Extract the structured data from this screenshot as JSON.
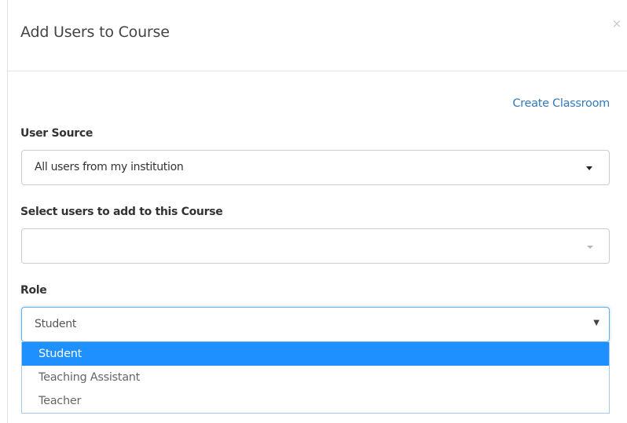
{
  "modal": {
    "title": "Add Users to Course",
    "close_glyph": "×",
    "create_classroom_label": "Create Classroom"
  },
  "user_source": {
    "label": "User Source",
    "value": "All users from my institution"
  },
  "select_users": {
    "label": "Select users to add to this Course",
    "value": ""
  },
  "role": {
    "label": "Role",
    "value": "Student",
    "caret_glyph": "▼",
    "options": [
      {
        "label": "Student",
        "selected": true
      },
      {
        "label": "Teaching Assistant",
        "selected": false
      },
      {
        "label": "Teacher",
        "selected": false
      }
    ]
  },
  "colors": {
    "link": "#337ab7",
    "highlight": "#1e90ff",
    "focus_border": "#66afe9"
  },
  "icons": {
    "close": "close-icon",
    "dropdown_caret": "chevron-down-icon"
  }
}
